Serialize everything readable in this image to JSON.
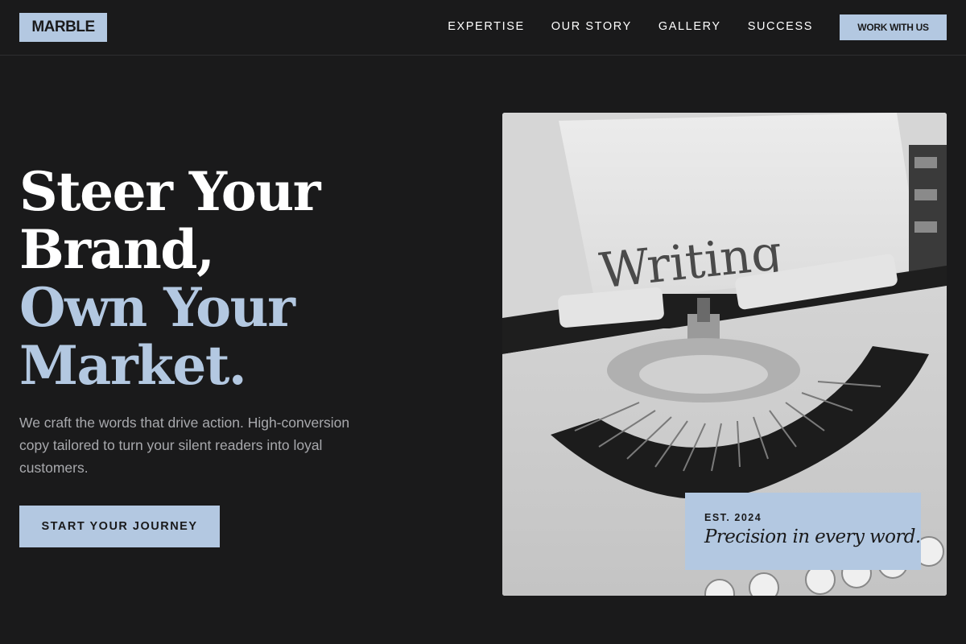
{
  "brand": {
    "logo_text": "MARBLE"
  },
  "nav": {
    "items": [
      {
        "label": "EXPERTISE"
      },
      {
        "label": "OUR STORY"
      },
      {
        "label": "GALLERY"
      },
      {
        "label": "SUCCESS"
      }
    ],
    "cta_label": "WORK WITH US"
  },
  "hero": {
    "headline_line1": "Steer Your",
    "headline_line2": "Brand,",
    "headline_line3": "Own Your",
    "headline_line4": "Market.",
    "subcopy": "We craft the words that drive action. High-conversion copy tailored to turn your silent readers into loyal customers.",
    "cta_label": "START YOUR JOURNEY"
  },
  "image": {
    "paper_text": "Writing",
    "badge_eyebrow": "EST. 2024",
    "badge_tagline": "Precision in every word."
  },
  "colors": {
    "background": "#1a1a1b",
    "accent": "#b3c8e1",
    "body_text": "#a8a9ad"
  }
}
